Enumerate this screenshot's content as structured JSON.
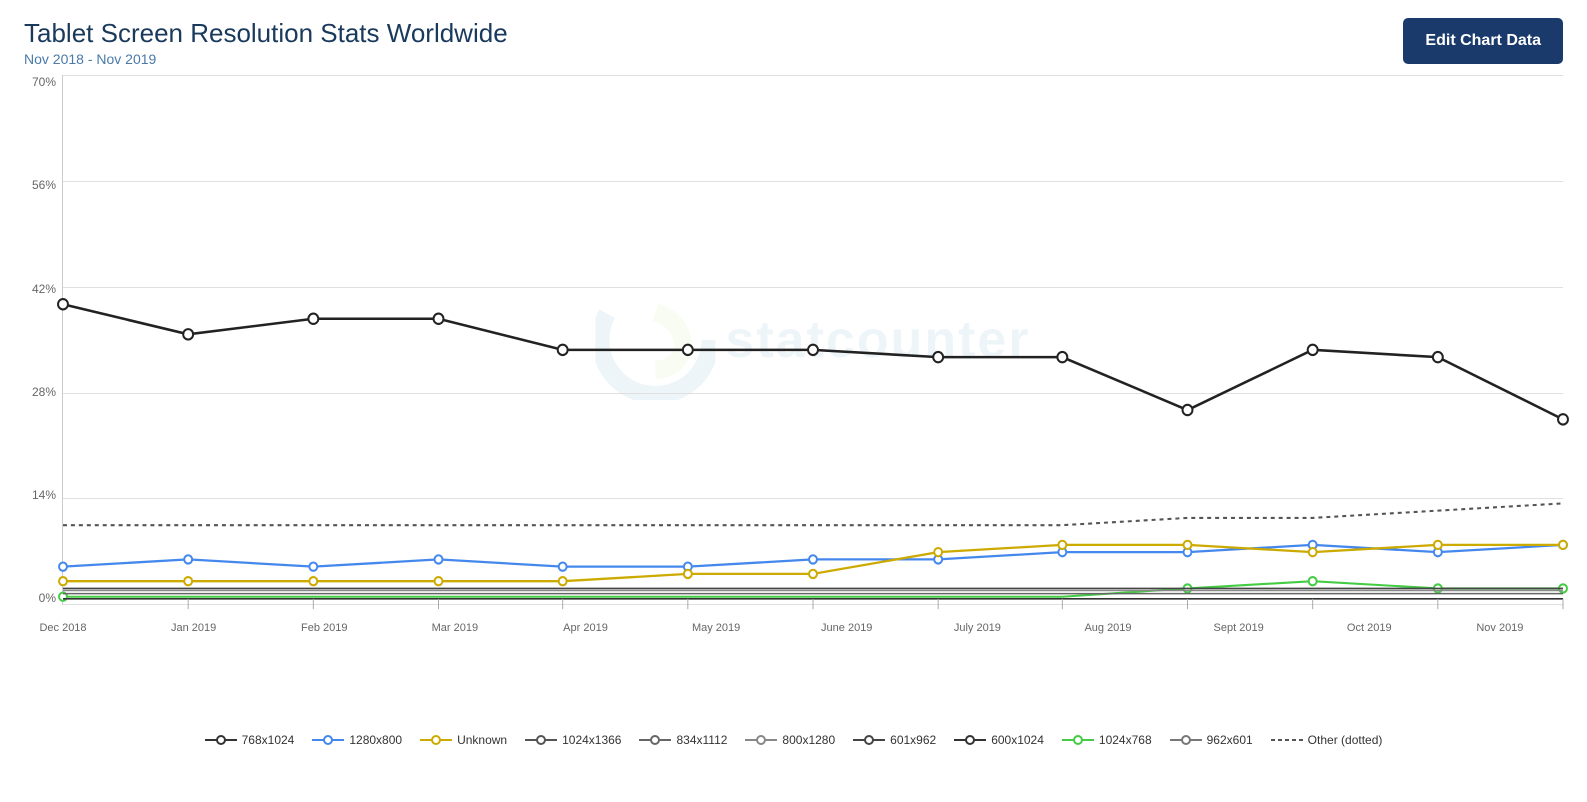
{
  "header": {
    "title": "Tablet Screen Resolution Stats Worldwide",
    "subtitle": "Nov 2018 - Nov 2019",
    "edit_button": "Edit Chart Data"
  },
  "chart": {
    "y_labels": [
      "70%",
      "56%",
      "42%",
      "28%",
      "14%",
      "0%"
    ],
    "x_labels": [
      "Dec 2018",
      "Jan 2019",
      "Feb 2019",
      "Mar 2019",
      "Apr 2019",
      "May 2019",
      "June 2019",
      "July 2019",
      "Aug 2019",
      "Sept 2019",
      "Oct 2019",
      "Nov 2019"
    ],
    "watermark": "statcounter"
  },
  "legend": {
    "items": [
      {
        "label": "768x1024",
        "color": "#333",
        "style": "solid",
        "dot": true
      },
      {
        "label": "1280x800",
        "color": "#4488ee",
        "style": "solid",
        "dot": true
      },
      {
        "label": "Unknown",
        "color": "#ccaa00",
        "style": "solid",
        "dot": true
      },
      {
        "label": "1024x1366",
        "color": "#555",
        "style": "solid",
        "dot": true
      },
      {
        "label": "834x1112",
        "color": "#555",
        "style": "solid",
        "dot": true
      },
      {
        "label": "800x1280",
        "color": "#555",
        "style": "solid",
        "dot": true
      },
      {
        "label": "601x962",
        "color": "#555",
        "style": "solid",
        "dot": true
      },
      {
        "label": "600x1024",
        "color": "#555",
        "style": "solid",
        "dot": true
      },
      {
        "label": "1024x768",
        "color": "#44cc44",
        "style": "solid",
        "dot": true
      },
      {
        "label": "962x601",
        "color": "#555",
        "style": "solid",
        "dot": true
      },
      {
        "label": "Other (dotted)",
        "color": "#555",
        "style": "dotted",
        "dot": false
      }
    ]
  }
}
